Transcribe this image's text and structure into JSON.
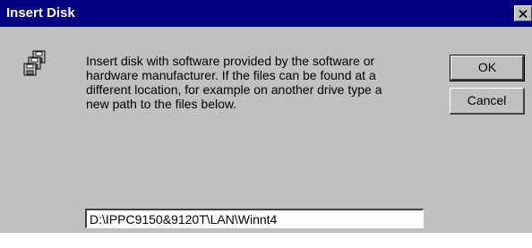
{
  "window": {
    "title": "Insert Disk",
    "close_glyph": "✕"
  },
  "icon": {
    "name": "floppy-disks-icon"
  },
  "message": {
    "lines": [
      "Insert disk with software provided by the software or",
      "hardware manufacturer.  If the files can be found at a",
      "different location, for example on another drive type a",
      "new path to the files below."
    ]
  },
  "buttons": {
    "ok_label": "OK",
    "cancel_label": "Cancel"
  },
  "path_input": {
    "value": "D:\\IPPC9150&9120T\\LAN\\Winnt4"
  },
  "colors": {
    "titlebar": "#000080",
    "dialog_face": "#c0c0c0",
    "title_text": "#ffffff"
  }
}
